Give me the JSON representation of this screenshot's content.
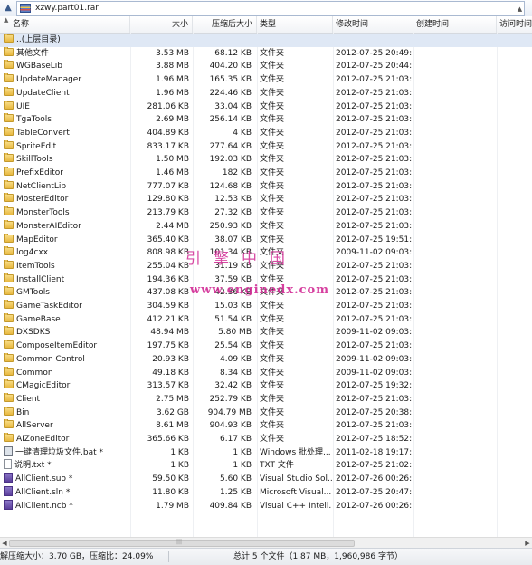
{
  "address": {
    "text": "xzwy.part01.rar",
    "up_arrow": "▲",
    "scroll_arrow": "▲"
  },
  "columns": {
    "sort_indicator": "▲",
    "name": "名称",
    "size": "大小",
    "packed": "压缩后大小",
    "type": "类型",
    "modified": "修改时间",
    "created": "创建时间",
    "accessed": "访问时间"
  },
  "rows": [
    {
      "name": "..(上层目录)",
      "size": "",
      "packed": "",
      "type": "",
      "modified": "",
      "icon": "folder-icon"
    },
    {
      "name": "其他文件",
      "size": "3.53 MB",
      "packed": "68.12 KB",
      "type": "文件夹",
      "modified": "2012-07-25 20:49:...",
      "icon": "folder-icon"
    },
    {
      "name": "WGBaseLib",
      "size": "3.88 MB",
      "packed": "404.20 KB",
      "type": "文件夹",
      "modified": "2012-07-25 20:44:...",
      "icon": "folder-icon"
    },
    {
      "name": "UpdateManager",
      "size": "1.96 MB",
      "packed": "165.35 KB",
      "type": "文件夹",
      "modified": "2012-07-25 21:03:...",
      "icon": "folder-icon"
    },
    {
      "name": "UpdateClient",
      "size": "1.96 MB",
      "packed": "224.46 KB",
      "type": "文件夹",
      "modified": "2012-07-25 21:03:...",
      "icon": "folder-icon"
    },
    {
      "name": "UIE",
      "size": "281.06 KB",
      "packed": "33.04 KB",
      "type": "文件夹",
      "modified": "2012-07-25 21:03:...",
      "icon": "folder-icon"
    },
    {
      "name": "TgaTools",
      "size": "2.69 MB",
      "packed": "256.14 KB",
      "type": "文件夹",
      "modified": "2012-07-25 21:03:...",
      "icon": "folder-icon"
    },
    {
      "name": "TableConvert",
      "size": "404.89 KB",
      "packed": "4 KB",
      "type": "文件夹",
      "modified": "2012-07-25 21:03:...",
      "icon": "folder-icon"
    },
    {
      "name": "SpriteEdit",
      "size": "833.17 KB",
      "packed": "277.64 KB",
      "type": "文件夹",
      "modified": "2012-07-25 21:03:...",
      "icon": "folder-icon"
    },
    {
      "name": "SkillTools",
      "size": "1.50 MB",
      "packed": "192.03 KB",
      "type": "文件夹",
      "modified": "2012-07-25 21:03:...",
      "icon": "folder-icon"
    },
    {
      "name": "PrefixEditor",
      "size": "1.46 MB",
      "packed": "182 KB",
      "type": "文件夹",
      "modified": "2012-07-25 21:03:...",
      "icon": "folder-icon"
    },
    {
      "name": "NetClientLib",
      "size": "777.07 KB",
      "packed": "124.68 KB",
      "type": "文件夹",
      "modified": "2012-07-25 21:03:...",
      "icon": "folder-icon"
    },
    {
      "name": "MosterEditor",
      "size": "129.80 KB",
      "packed": "12.53 KB",
      "type": "文件夹",
      "modified": "2012-07-25 21:03:...",
      "icon": "folder-icon"
    },
    {
      "name": "MonsterTools",
      "size": "213.79 KB",
      "packed": "27.32 KB",
      "type": "文件夹",
      "modified": "2012-07-25 21:03:...",
      "icon": "folder-icon"
    },
    {
      "name": "MonsterAIEditor",
      "size": "2.44 MB",
      "packed": "250.93 KB",
      "type": "文件夹",
      "modified": "2012-07-25 21:03:...",
      "icon": "folder-icon"
    },
    {
      "name": "MapEditor",
      "size": "365.40 KB",
      "packed": "38.07 KB",
      "type": "文件夹",
      "modified": "2012-07-25 19:51:...",
      "icon": "folder-icon"
    },
    {
      "name": "log4cxx",
      "size": "808.98 KB",
      "packed": "101.34 KB",
      "type": "文件夹",
      "modified": "2009-11-02 09:03:...",
      "icon": "folder-icon"
    },
    {
      "name": "ItemTools",
      "size": "255.04 KB",
      "packed": "31.19 KB",
      "type": "文件夹",
      "modified": "2012-07-25 21:03:...",
      "icon": "folder-icon"
    },
    {
      "name": "InstallClient",
      "size": "194.36 KB",
      "packed": "37.59 KB",
      "type": "文件夹",
      "modified": "2012-07-25 21:03:...",
      "icon": "folder-icon"
    },
    {
      "name": "GMTools",
      "size": "437.08 KB",
      "packed": "42.36 KB",
      "type": "文件夹",
      "modified": "2012-07-25 21:03:...",
      "icon": "folder-icon"
    },
    {
      "name": "GameTaskEditor",
      "size": "304.59 KB",
      "packed": "15.03 KB",
      "type": "文件夹",
      "modified": "2012-07-25 21:03:...",
      "icon": "folder-icon"
    },
    {
      "name": "GameBase",
      "size": "412.21 KB",
      "packed": "51.54 KB",
      "type": "文件夹",
      "modified": "2012-07-25 21:03:...",
      "icon": "folder-icon"
    },
    {
      "name": "DXSDKS",
      "size": "48.94 MB",
      "packed": "5.80 MB",
      "type": "文件夹",
      "modified": "2009-11-02 09:03:...",
      "icon": "folder-icon"
    },
    {
      "name": "ComposeItemEditor",
      "size": "197.75 KB",
      "packed": "25.54 KB",
      "type": "文件夹",
      "modified": "2012-07-25 21:03:...",
      "icon": "folder-icon"
    },
    {
      "name": "Common Control",
      "size": "20.93 KB",
      "packed": "4.09 KB",
      "type": "文件夹",
      "modified": "2009-11-02 09:03:...",
      "icon": "folder-icon"
    },
    {
      "name": "Common",
      "size": "49.18 KB",
      "packed": "8.34 KB",
      "type": "文件夹",
      "modified": "2009-11-02 09:03:...",
      "icon": "folder-icon"
    },
    {
      "name": "CMagicEditor",
      "size": "313.57 KB",
      "packed": "32.42 KB",
      "type": "文件夹",
      "modified": "2012-07-25 19:32:...",
      "icon": "folder-icon"
    },
    {
      "name": "Client",
      "size": "2.75 MB",
      "packed": "252.79 KB",
      "type": "文件夹",
      "modified": "2012-07-25 21:03:...",
      "icon": "folder-icon"
    },
    {
      "name": "Bin",
      "size": "3.62 GB",
      "packed": "904.79 MB",
      "type": "文件夹",
      "modified": "2012-07-25 20:38:...",
      "icon": "folder-icon"
    },
    {
      "name": "AllServer",
      "size": "8.61 MB",
      "packed": "904.93 KB",
      "type": "文件夹",
      "modified": "2012-07-25 21:03:...",
      "icon": "folder-icon"
    },
    {
      "name": "AIZoneEditor",
      "size": "365.66 KB",
      "packed": "6.17 KB",
      "type": "文件夹",
      "modified": "2012-07-25 18:52:...",
      "icon": "folder-icon"
    },
    {
      "name": "一键清理垃圾文件.bat *",
      "size": "1 KB",
      "packed": "1 KB",
      "type": "Windows 批处理...",
      "modified": "2011-02-18 19:17:...",
      "icon": "batch-file-icon"
    },
    {
      "name": "说明.txt *",
      "size": "1 KB",
      "packed": "1 KB",
      "type": "TXT 文件",
      "modified": "2012-07-25 21:02:...",
      "icon": "text-file-icon"
    },
    {
      "name": "AllClient.suo *",
      "size": "59.50 KB",
      "packed": "5.60 KB",
      "type": "Visual Studio Sol...",
      "modified": "2012-07-26 00:26:...",
      "icon": "visual-studio-file-icon"
    },
    {
      "name": "AllClient.sln *",
      "size": "11.80 KB",
      "packed": "1.25 KB",
      "type": "Microsoft Visual...",
      "modified": "2012-07-25 20:47:...",
      "icon": "visual-studio-file-icon"
    },
    {
      "name": "AllClient.ncb *",
      "size": "1.79 MB",
      "packed": "409.84 KB",
      "type": "Visual C++ Intell...",
      "modified": "2012-07-26 00:26:...",
      "icon": "visual-studio-file-icon"
    }
  ],
  "watermark": {
    "line1": "引擎中国",
    "line2": "www.enginedx.com"
  },
  "scrollbar": {
    "left_arrow": "◀",
    "right_arrow": "▶",
    "grip": "|||"
  },
  "status": {
    "left": "解压缩大小：3.70 GB，压缩比：24.09%",
    "right": "总计 5 个文件（1.87 MB，1,960,986 字节）"
  },
  "colors": {
    "folder": "#e8b940",
    "selection": "#dfe8f5",
    "watermark": "#d22b95"
  }
}
